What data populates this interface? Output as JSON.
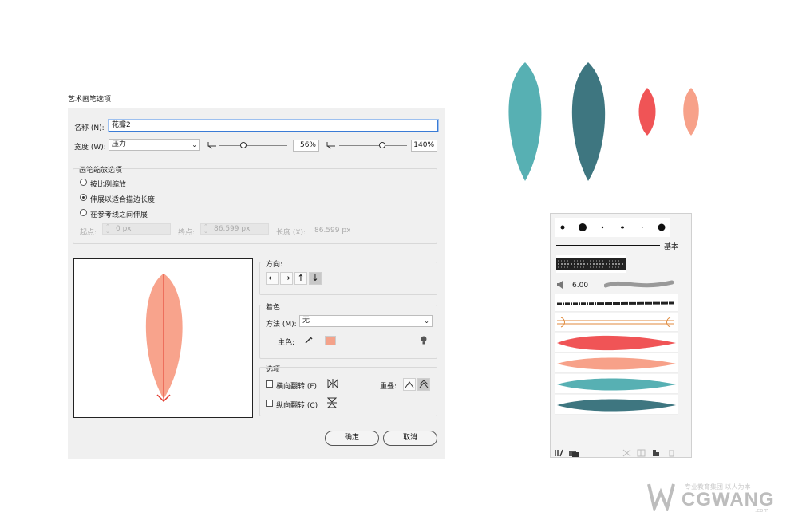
{
  "dialog": {
    "title": "艺术画笔选项",
    "name_label": "名称 (N):",
    "name_value": "花瓣2",
    "width_label": "宽度 (W):",
    "width_value": "压力",
    "width_pct": "56%",
    "width_pct_level": 0.35,
    "width2_pct": "140%",
    "width2_level": 0.64,
    "scale": {
      "title": "画笔缩放选项",
      "option1": "按比例缩放",
      "option2": "伸展以适合描边长度",
      "option3": "在参考线之间伸展",
      "selected": "伸展以适合描边长度",
      "start_label": "起点:",
      "start_value": "0 px",
      "end_label": "终点:",
      "end_value": "86.599 px",
      "length_label": "长度 (X):",
      "length_value": "86.599 px"
    },
    "direction": {
      "title": "方向:",
      "left": "←",
      "right": "→",
      "up": "↑",
      "down": "↓",
      "selected": "down"
    },
    "colorization": {
      "title": "着色",
      "method_label": "方法 (M):",
      "method_value": "无",
      "key_color_label": "主色:",
      "key_color": "#f4a28a"
    },
    "options": {
      "title": "选项",
      "flip_along": "横向翻转 (F)",
      "flip_across": "纵向翻转 (C)",
      "overlap_label": "重叠:"
    },
    "ok": "确定",
    "cancel": "取消"
  },
  "panel": {
    "basic_label": "基本",
    "stroke_size": "6.00"
  },
  "colors": {
    "teal_light": "#57b0b3",
    "teal_dark": "#3e7680",
    "red": "#f05456",
    "peach": "#f7a189",
    "preview_petal": "#f8a38c"
  },
  "logo": {
    "text": "CGWANG",
    "slogan": "专业教育集团 以人为本",
    "sub": ".com"
  }
}
